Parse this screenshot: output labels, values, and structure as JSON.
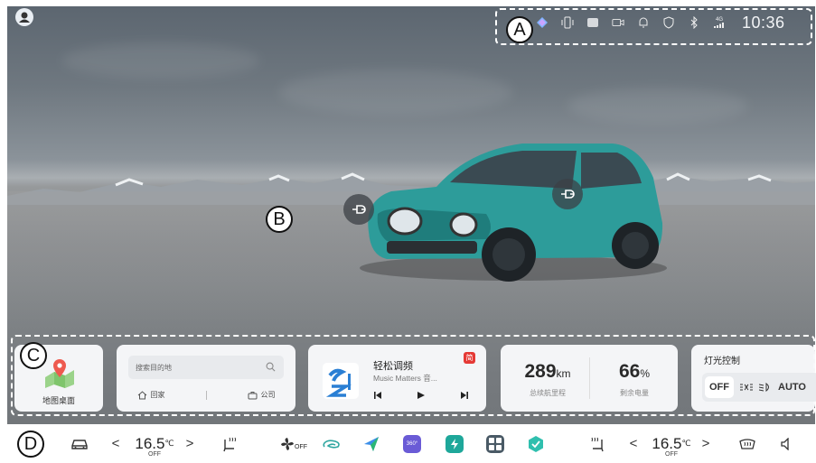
{
  "status_bar": {
    "time": "10:36",
    "icons": [
      "assistant-icon",
      "vibration-icon",
      "screen-mirror-icon",
      "camera-icon",
      "bell-icon",
      "shield-icon",
      "bluetooth-icon",
      "signal-4g-icon"
    ],
    "signal_label": "4G"
  },
  "markers": {
    "a": "A",
    "b": "B",
    "c": "C",
    "d": "D"
  },
  "cards": {
    "map": {
      "label": "地图桌面"
    },
    "nav": {
      "search_placeholder": "搜索目的地",
      "home_label": "回家",
      "work_label": "公司"
    },
    "music": {
      "title": "轻松调频",
      "subtitle": "Music Matters 音...",
      "badge": "简"
    },
    "range": {
      "range_value": "289",
      "range_unit": "km",
      "range_label": "总续航里程",
      "battery_value": "66",
      "battery_unit": "%",
      "battery_label": "剩余电量"
    },
    "light": {
      "title": "灯光控制",
      "off_label": "OFF",
      "auto_label": "AUTO"
    }
  },
  "dock": {
    "left_temp": "16.5",
    "left_temp_unit": "℃",
    "left_temp_state": "OFF",
    "fan_state": "OFF",
    "right_temp": "16.5",
    "right_temp_unit": "℃",
    "right_temp_state": "OFF",
    "chevron_left": "<",
    "chevron_right": ">",
    "app_360_label": "360°"
  },
  "colors": {
    "accent_teal": "#2fa6a0",
    "car_body": "#2d9c9a",
    "dock_bg": "#ffffff"
  }
}
